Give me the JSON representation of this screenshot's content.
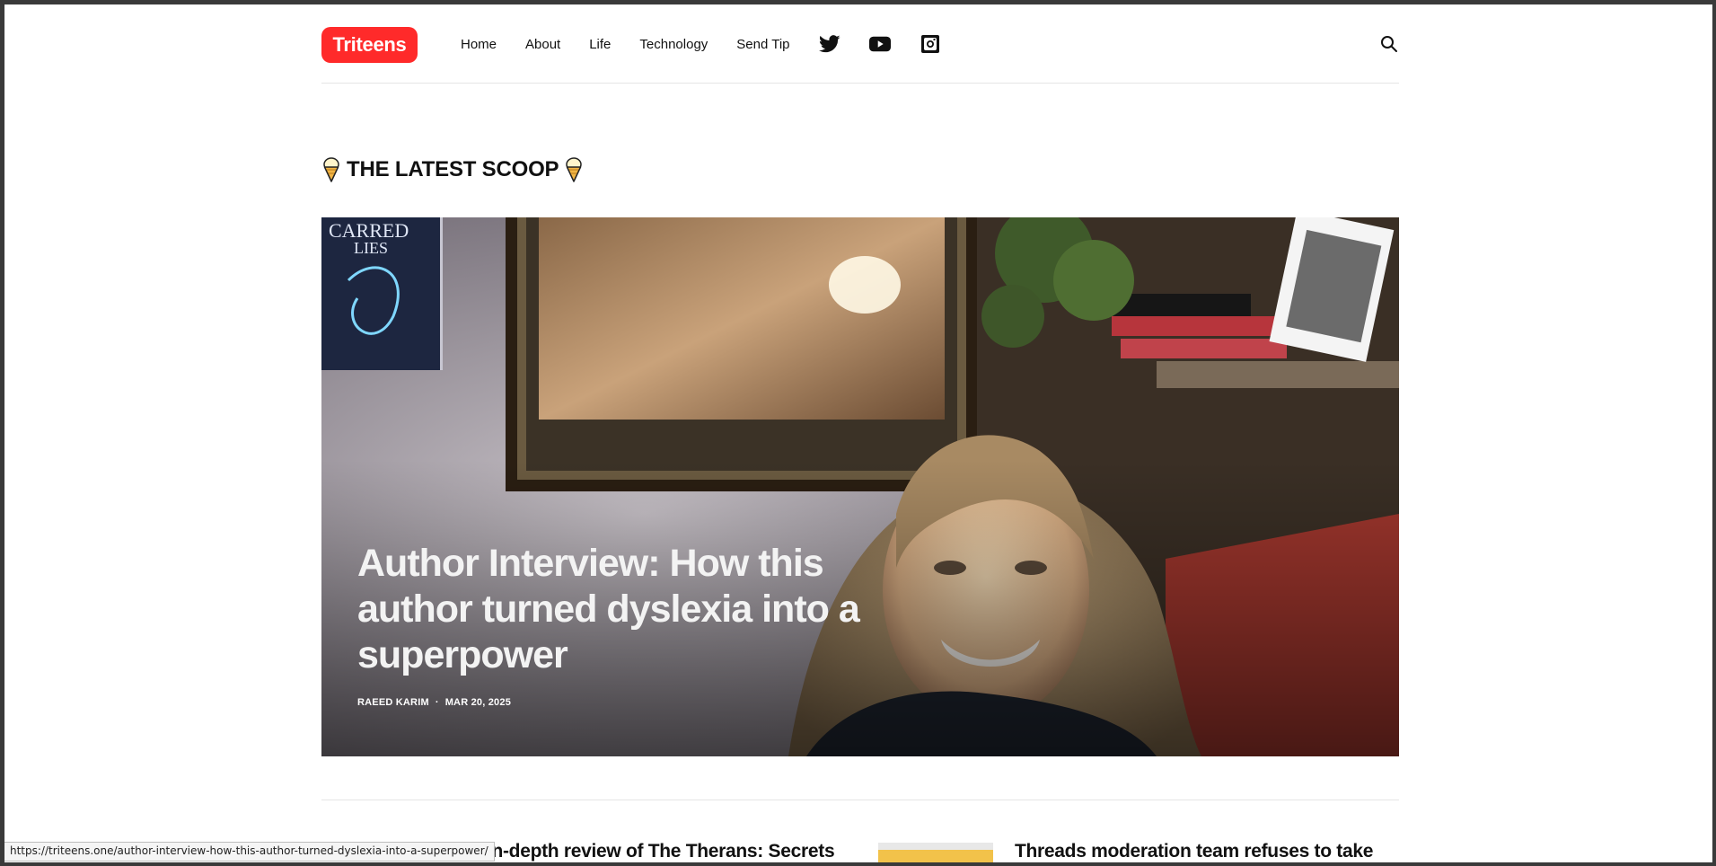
{
  "brand": {
    "name": "Triteens",
    "color": "#ff2a2a"
  },
  "nav": {
    "items": [
      "Home",
      "About",
      "Life",
      "Technology",
      "Send Tip"
    ],
    "social": [
      {
        "icon": "twitter-icon"
      },
      {
        "icon": "youtube-icon"
      },
      {
        "icon": "instagram-icon"
      }
    ],
    "search_icon": "search-icon"
  },
  "section": {
    "title": "THE LATEST SCOOP",
    "icon": "ice-cream-icon"
  },
  "hero": {
    "title": "Author Interview: How this author turned dyslexia into a superpower",
    "author": "RAEED KARIM",
    "separator": "·",
    "date": "MAR 20, 2025"
  },
  "cards": [
    {
      "title": "An in-depth review of The Therans: Secrets"
    },
    {
      "title": "Threads moderation team refuses to take"
    }
  ],
  "status_bar": {
    "url": "https://triteens.one/author-interview-how-this-author-turned-dyslexia-into-a-superpower/"
  }
}
